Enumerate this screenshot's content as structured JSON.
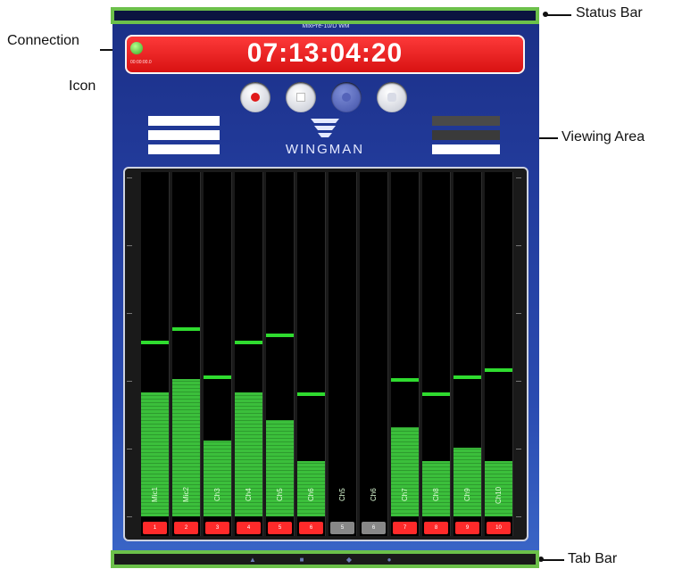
{
  "callouts": {
    "status_bar": "Status Bar",
    "connection_line1": "Connection",
    "connection_line2": "Icon",
    "viewing_area": "Viewing Area",
    "tab_bar": "Tab Bar"
  },
  "device": {
    "device_title": "MixPre-10/D WM",
    "timecode": "07:13:04:20",
    "connection_label": "00:00:00.0"
  },
  "channels": [
    {
      "name": "Mic1",
      "button": "1",
      "button_color": "#ff2a2a",
      "level": 0.36,
      "peak": 0.5
    },
    {
      "name": "Mic2",
      "button": "2",
      "button_color": "#ff2a2a",
      "level": 0.4,
      "peak": 0.54
    },
    {
      "name": "Ch3",
      "button": "3",
      "button_color": "#ff2a2a",
      "level": 0.22,
      "peak": 0.4
    },
    {
      "name": "Ch4",
      "button": "4",
      "button_color": "#ff2a2a",
      "level": 0.36,
      "peak": 0.5
    },
    {
      "name": "Ch5",
      "button": "5",
      "button_color": "#ff2a2a",
      "level": 0.28,
      "peak": 0.52
    },
    {
      "name": "Ch6",
      "button": "6",
      "button_color": "#ff2a2a",
      "level": 0.16,
      "peak": 0.35
    },
    {
      "name": "Ch5",
      "button": "5",
      "button_color": "#888888",
      "level": 0.0,
      "peak": 0.0
    },
    {
      "name": "Ch6",
      "button": "6",
      "button_color": "#888888",
      "level": 0.0,
      "peak": 0.0
    },
    {
      "name": "Ch7",
      "button": "7",
      "button_color": "#ff2a2a",
      "level": 0.26,
      "peak": 0.39
    },
    {
      "name": "Ch8",
      "button": "8",
      "button_color": "#ff2a2a",
      "level": 0.16,
      "peak": 0.35
    },
    {
      "name": "Ch9",
      "button": "9",
      "button_color": "#ff2a2a",
      "level": 0.2,
      "peak": 0.4
    },
    {
      "name": "Ch10",
      "button": "10",
      "button_color": "#ff2a2a",
      "level": 0.16,
      "peak": 0.42
    }
  ],
  "colors": {
    "highlight_box": "#6cc04a",
    "timecode_bg": "#e21b1b",
    "meter_green": "#3bbf3b"
  },
  "logo": {
    "word": "WINGMAN"
  },
  "tabs": [
    "tab-1-icon",
    "tab-2-icon",
    "tab-3-icon",
    "tab-4-icon"
  ]
}
